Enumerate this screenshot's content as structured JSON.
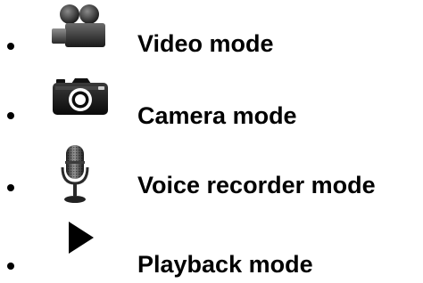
{
  "modes": [
    {
      "label": "Video mode",
      "icon": "video-camera-icon"
    },
    {
      "label": "Camera mode",
      "icon": "camera-icon"
    },
    {
      "label": "Voice recorder mode",
      "icon": "microphone-icon"
    },
    {
      "label": "Playback mode",
      "icon": "play-icon"
    }
  ]
}
